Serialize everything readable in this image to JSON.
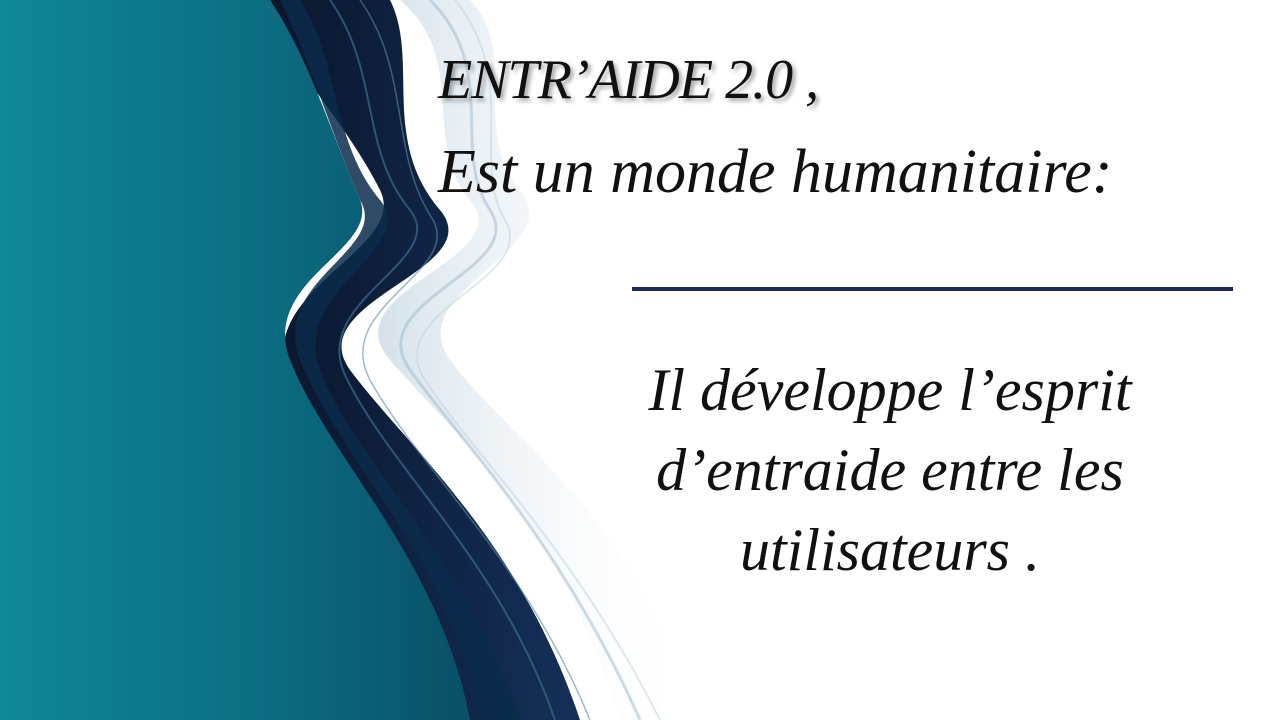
{
  "slide": {
    "title": "ENTR’AIDE 2.0 ,",
    "subtitle": "Est un monde humanitaire:",
    "body_lines": [
      "Il développe l’esprit",
      "d’entraide entre les",
      "utilisateurs ."
    ]
  },
  "colors": {
    "teal_dark": "#0a5f73",
    "teal_light": "#0f8896",
    "navy": "#0b1530",
    "divider": "#1b2a5a",
    "text": "#111111"
  },
  "icons": {
    "background": "wave-ribbon-decoration"
  }
}
